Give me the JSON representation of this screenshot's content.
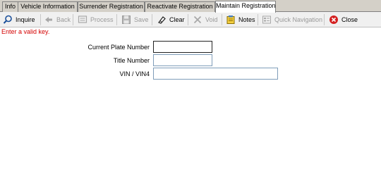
{
  "tabs": [
    {
      "label": "Info"
    },
    {
      "label": "Vehicle Information"
    },
    {
      "label": "Surrender Registration"
    },
    {
      "label": "Reactivate Registration"
    },
    {
      "label": "Maintain Registration"
    }
  ],
  "active_tab": "Maintain Registration",
  "toolbar": {
    "inquire": "Inquire",
    "back": "Back",
    "process": "Process",
    "save": "Save",
    "clear": "Clear",
    "void": "Void",
    "notes": "Notes",
    "quick_navigation": "Quick Navigation",
    "close": "Close"
  },
  "error_message": "Enter a valid key.",
  "form": {
    "plate_label": "Current Plate Number",
    "plate_value": "",
    "title_label": "Title Number",
    "title_value": "",
    "vin_label": "VIN / VIN4",
    "vin_value": ""
  },
  "colors": {
    "error": "#d40000",
    "close_icon": "#d42020",
    "tab_bar": "#d4d0c8"
  }
}
